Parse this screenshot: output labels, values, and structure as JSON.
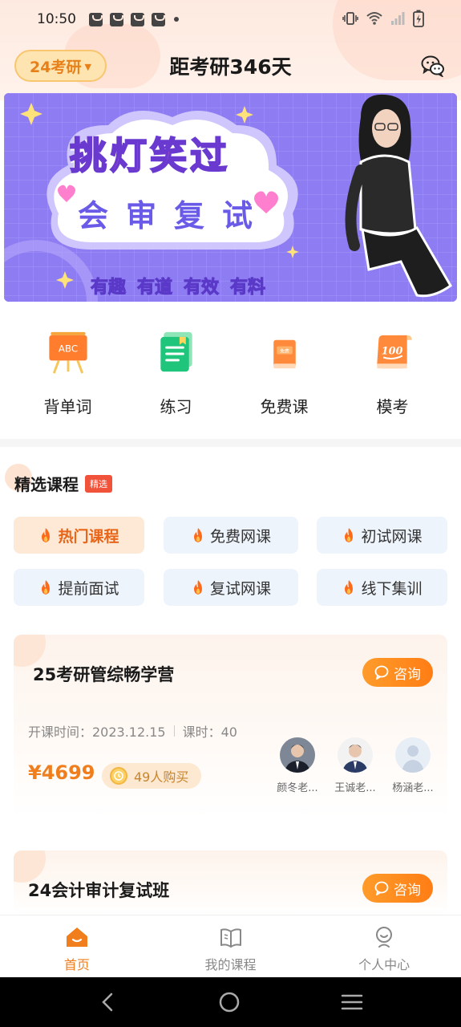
{
  "status_bar": {
    "time": "10:50"
  },
  "header": {
    "exam_selector": "24考研",
    "countdown_title": "距考研346天"
  },
  "banner": {
    "headline": "挑灯笑过",
    "subheadline": "会审复试",
    "tags": [
      "有趣",
      "有道",
      "有效",
      "有料"
    ]
  },
  "quick_nav": [
    {
      "label": "背单词",
      "icon": "abc-board-icon"
    },
    {
      "label": "练习",
      "icon": "notebook-icon"
    },
    {
      "label": "免费课",
      "icon": "free-book-icon"
    },
    {
      "label": "模考",
      "icon": "score-100-icon"
    }
  ],
  "section": {
    "title": "精选课程",
    "badge": "精选"
  },
  "chips": [
    "热门课程",
    "免费网课",
    "初试网课",
    "提前面试",
    "复试网课",
    "线下集训"
  ],
  "courses": [
    {
      "title": "25考研管综畅学营",
      "consult": "咨询",
      "start_label": "开课时间：2023.12.15",
      "hours_label": "课时：40",
      "price": "¥4699",
      "buyers": "49人购买",
      "teachers": [
        "颜冬老...",
        "王诚老...",
        "杨涵老..."
      ]
    },
    {
      "title": "24会计审计复试班",
      "consult": "咨询"
    }
  ],
  "bottom_nav": [
    {
      "label": "首页",
      "icon": "home-icon",
      "active": true
    },
    {
      "label": "我的课程",
      "icon": "open-book-icon",
      "active": false
    },
    {
      "label": "个人中心",
      "icon": "user-icon",
      "active": false
    }
  ],
  "colors": {
    "accent": "#f07e1c",
    "banner_bg": "#8e7cf2",
    "chip_bg": "#eef4fc"
  }
}
